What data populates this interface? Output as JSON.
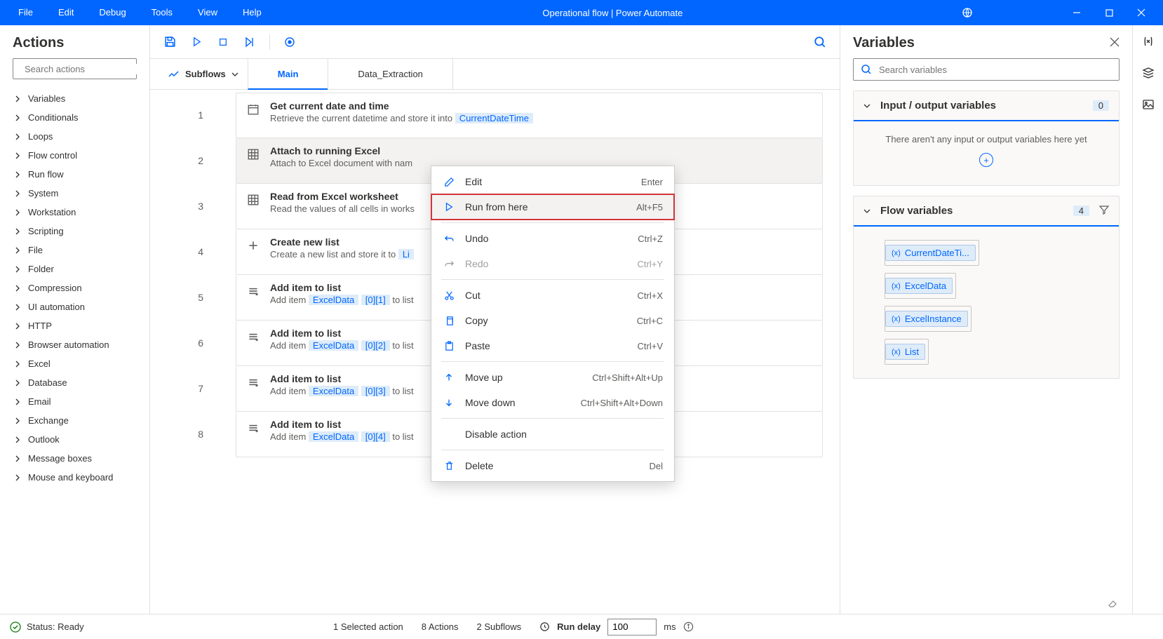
{
  "titlebar": {
    "menu": [
      "File",
      "Edit",
      "Debug",
      "Tools",
      "View",
      "Help"
    ],
    "title": "Operational flow | Power Automate"
  },
  "actions": {
    "heading": "Actions",
    "search_placeholder": "Search actions",
    "categories": [
      "Variables",
      "Conditionals",
      "Loops",
      "Flow control",
      "Run flow",
      "System",
      "Workstation",
      "Scripting",
      "File",
      "Folder",
      "Compression",
      "UI automation",
      "HTTP",
      "Browser automation",
      "Excel",
      "Database",
      "Email",
      "Exchange",
      "Outlook",
      "Message boxes",
      "Mouse and keyboard"
    ]
  },
  "editor": {
    "subflows_label": "Subflows",
    "tabs": [
      {
        "label": "Main",
        "active": true
      },
      {
        "label": "Data_Extraction",
        "active": false
      }
    ],
    "steps": [
      {
        "n": "1",
        "title": "Get current date and time",
        "desc_pre": "Retrieve the current datetime and store it into ",
        "token": "CurrentDateTime",
        "desc_post": ""
      },
      {
        "n": "2",
        "title": "Attach to running Excel",
        "desc_pre": "Attach to Excel document with nam",
        "token": "",
        "desc_post": "",
        "selected": true
      },
      {
        "n": "3",
        "title": "Read from Excel worksheet",
        "desc_pre": "Read the values of all cells in works",
        "token": "",
        "desc_post": ""
      },
      {
        "n": "4",
        "title": "Create new list",
        "desc_pre": "Create a new list and store it to ",
        "token": "Li",
        "desc_post": ""
      },
      {
        "n": "5",
        "title": "Add item to list",
        "desc_pre": "Add item ",
        "token": "ExcelData",
        "idx": "[0][1]",
        "desc_post": " to list"
      },
      {
        "n": "6",
        "title": "Add item to list",
        "desc_pre": "Add item ",
        "token": "ExcelData",
        "idx": "[0][2]",
        "desc_post": " to list"
      },
      {
        "n": "7",
        "title": "Add item to list",
        "desc_pre": "Add item ",
        "token": "ExcelData",
        "idx": "[0][3]",
        "desc_post": " to list"
      },
      {
        "n": "8",
        "title": "Add item to list",
        "desc_pre": "Add item ",
        "token": "ExcelData",
        "idx": "[0][4]",
        "desc_post": " to list"
      }
    ]
  },
  "context_menu": [
    {
      "label": "Edit",
      "shortcut": "Enter",
      "icon": "edit"
    },
    {
      "label": "Run from here",
      "shortcut": "Alt+F5",
      "icon": "play",
      "highlight": true
    },
    {
      "sep": true
    },
    {
      "label": "Undo",
      "shortcut": "Ctrl+Z",
      "icon": "undo"
    },
    {
      "label": "Redo",
      "shortcut": "Ctrl+Y",
      "icon": "redo",
      "disabled": true
    },
    {
      "sep": true
    },
    {
      "label": "Cut",
      "shortcut": "Ctrl+X",
      "icon": "cut"
    },
    {
      "label": "Copy",
      "shortcut": "Ctrl+C",
      "icon": "copy"
    },
    {
      "label": "Paste",
      "shortcut": "Ctrl+V",
      "icon": "paste"
    },
    {
      "sep": true
    },
    {
      "label": "Move up",
      "shortcut": "Ctrl+Shift+Alt+Up",
      "icon": "up"
    },
    {
      "label": "Move down",
      "shortcut": "Ctrl+Shift+Alt+Down",
      "icon": "down"
    },
    {
      "sep": true
    },
    {
      "label": "Disable action",
      "shortcut": "",
      "icon": ""
    },
    {
      "sep": true
    },
    {
      "label": "Delete",
      "shortcut": "Del",
      "icon": "delete"
    }
  ],
  "variables": {
    "heading": "Variables",
    "search_placeholder": "Search variables",
    "io": {
      "title": "Input / output variables",
      "count": "0",
      "empty": "There aren't any input or output variables here yet"
    },
    "flow": {
      "title": "Flow variables",
      "count": "4",
      "items": [
        "CurrentDateTi...",
        "ExcelData",
        "ExcelInstance",
        "List"
      ]
    }
  },
  "statusbar": {
    "status": "Status: Ready",
    "selected": "1 Selected action",
    "actions": "8 Actions",
    "subflows": "2 Subflows",
    "delay_label": "Run delay",
    "delay_value": "100",
    "delay_unit": "ms"
  }
}
